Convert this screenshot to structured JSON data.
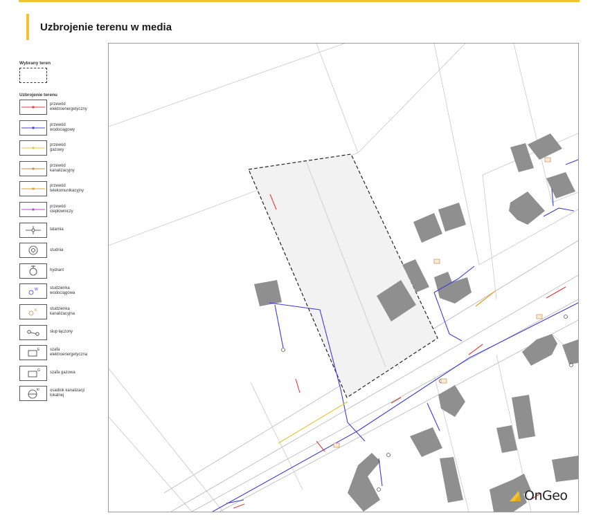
{
  "title": "Uzbrojenie terenu w media",
  "legend": {
    "selected_title": "Wybrany teren",
    "utilities_title": "Uzbrojenie terenu",
    "items": [
      {
        "l1": "przewód",
        "l2": "elektroenergetyczny",
        "color": "#e03a3a",
        "icon": "line-icon"
      },
      {
        "l1": "przewód",
        "l2": "wodociągowy",
        "color": "#3c3cd6",
        "icon": "line-icon"
      },
      {
        "l1": "przewód",
        "l2": "gazowy",
        "color": "#e6c83a",
        "icon": "line-icon"
      },
      {
        "l1": "przewód",
        "l2": "kanalizacyjny",
        "color": "#c98a4a",
        "icon": "line-icon"
      },
      {
        "l1": "przewód",
        "l2": "telekomunikacyjny",
        "color": "#e0a020",
        "icon": "line-icon"
      },
      {
        "l1": "przewód",
        "l2": "ciepłowniczy",
        "color": "#b04ad0",
        "icon": "line-icon"
      },
      {
        "l1": "latarnia",
        "l2": "",
        "color": "#333333",
        "icon": "lamp-icon"
      },
      {
        "l1": "studnia",
        "l2": "",
        "color": "#333333",
        "icon": "well-icon"
      },
      {
        "l1": "hydrant",
        "l2": "",
        "color": "#333333",
        "icon": "hydrant-icon"
      },
      {
        "l1": "studzienka",
        "l2": "wodociągowa",
        "color": "#3c3cd6",
        "icon": "manhole-water-icon"
      },
      {
        "l1": "studzienka",
        "l2": "kanalizacyjna",
        "color": "#c98a4a",
        "icon": "manhole-sewer-icon"
      },
      {
        "l1": "słup łączony",
        "l2": "",
        "color": "#333333",
        "icon": "pole-icon"
      },
      {
        "l1": "szafa",
        "l2": "elektroenergetyczna",
        "color": "#333333",
        "icon": "power-cabinet-icon"
      },
      {
        "l1": "szafa gazowa",
        "l2": "",
        "color": "#333333",
        "icon": "gas-cabinet-icon"
      },
      {
        "l1": "osadnik kanalizacji",
        "l2": "lokalnej",
        "color": "#333333",
        "icon": "septic-tank-icon"
      }
    ]
  },
  "logo": {
    "text": "OnGeo",
    "color": "#f2c230"
  },
  "colors": {
    "accent": "#f2c230",
    "building": "#8f8f8f",
    "parcel_fill": "#f2f2f2"
  }
}
